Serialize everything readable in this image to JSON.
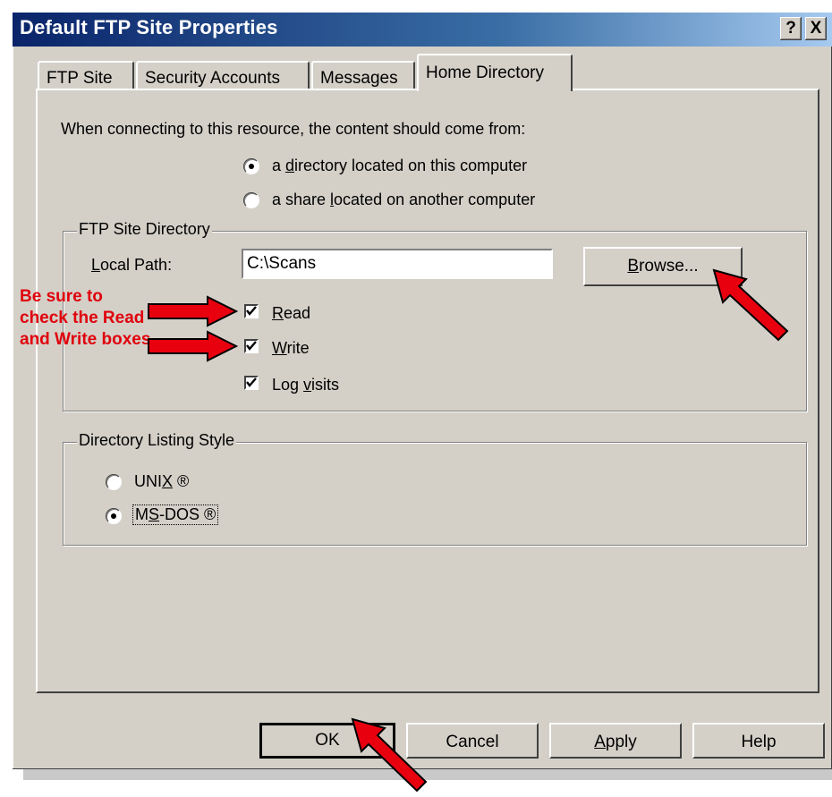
{
  "window": {
    "title": "Default FTP Site Properties",
    "help_button": "?",
    "close_button": "X"
  },
  "tabs": [
    {
      "label": "FTP Site",
      "active": false
    },
    {
      "label": "Security Accounts",
      "active": false
    },
    {
      "label": "Messages",
      "active": false
    },
    {
      "label": "Home Directory",
      "active": true
    }
  ],
  "content_source": {
    "prompt": "When connecting to this resource, the content should come from:",
    "options": [
      {
        "label": "a directory located on this computer",
        "selected": true
      },
      {
        "label": "a share located on another computer",
        "selected": false
      }
    ]
  },
  "ftp_site_directory": {
    "group_label": "FTP Site Directory",
    "local_path_label": "Local Path:",
    "local_path_value": "C:\\Scans",
    "browse_button": "Browse...",
    "permissions": [
      {
        "label": "Read",
        "checked": true
      },
      {
        "label": "Write",
        "checked": true
      },
      {
        "label": "Log visits",
        "checked": true
      }
    ]
  },
  "listing_style": {
    "group_label": "Directory Listing Style",
    "options": [
      {
        "label": "UNIX ®",
        "selected": false
      },
      {
        "label": "MS-DOS ®",
        "selected": true
      }
    ]
  },
  "footer": {
    "ok": "OK",
    "cancel": "Cancel",
    "apply": "Apply",
    "help": "Help"
  },
  "annotation": {
    "note": "Be sure to check the Read and Write boxes",
    "color": "#e0000c"
  }
}
